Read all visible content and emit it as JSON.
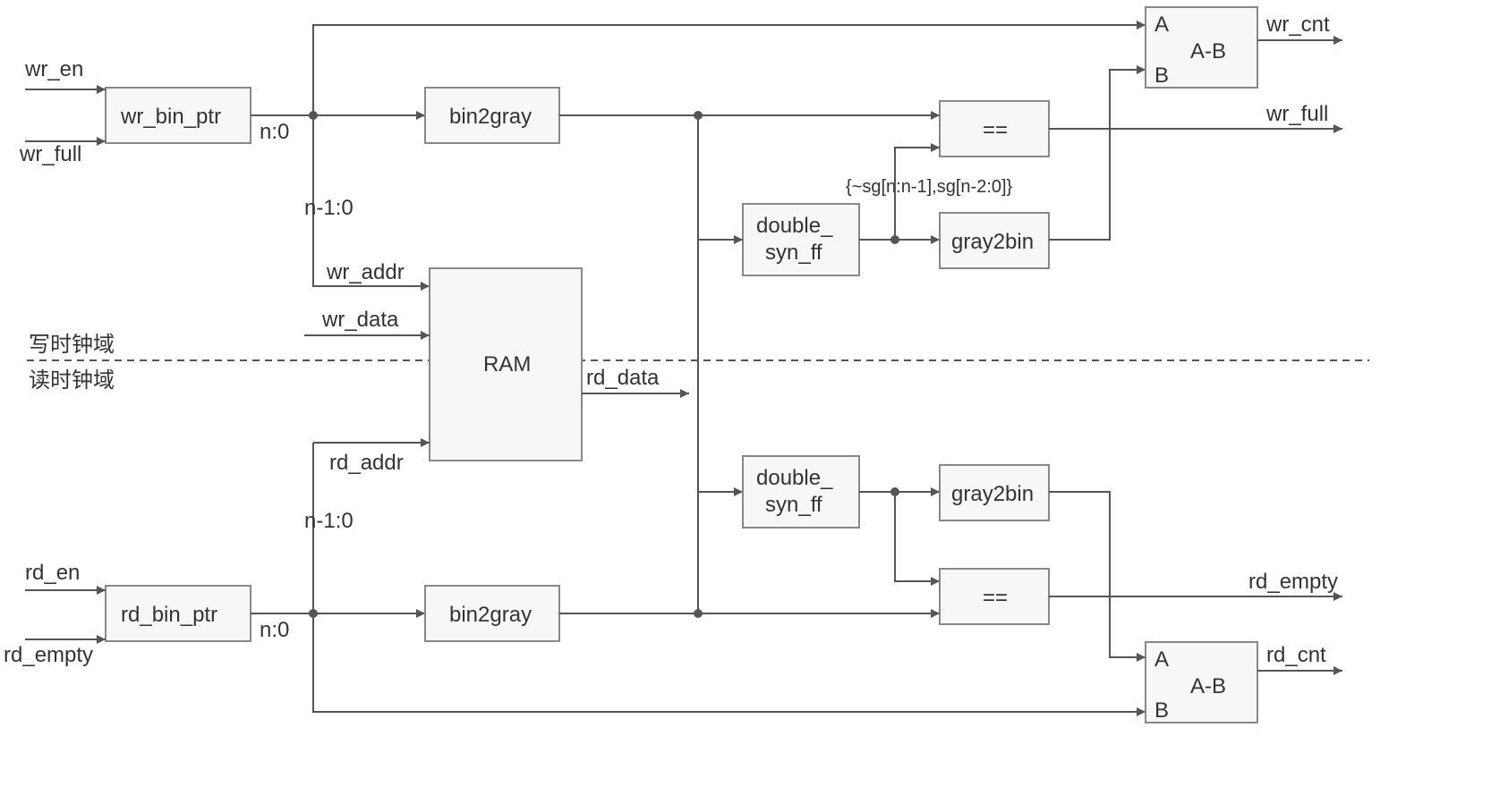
{
  "signals": {
    "wr_en": "wr_en",
    "wr_full": "wr_full",
    "rd_en": "rd_en",
    "rd_empty": "rd_empty",
    "wr_addr": "wr_addr",
    "wr_data": "wr_data",
    "rd_addr": "rd_addr",
    "rd_data": "rd_data",
    "wr_cnt": "wr_cnt",
    "wr_full_out": "wr_full",
    "rd_empty_out": "rd_empty",
    "rd_cnt": "rd_cnt",
    "n0_top": "n:0",
    "n0_bot": "n:0",
    "n1_top": "n-1:0",
    "n1_bot": "n-1:0",
    "sg_expr": "{~sg[n:n-1],sg[n-2:0]}",
    "A_top": "A",
    "B_top": "B",
    "A_bot": "A",
    "B_bot": "B"
  },
  "blocks": {
    "wr_bin_ptr": "wr_bin_ptr",
    "rd_bin_ptr": "rd_bin_ptr",
    "bin2gray_top": "bin2gray",
    "bin2gray_bot": "bin2gray",
    "ram": "RAM",
    "dsyn_top": "double_\nsyn_ff",
    "dsyn_bot": "double_\nsyn_ff",
    "gray2bin_top": "gray2bin",
    "gray2bin_bot": "gray2bin",
    "eq_top": "==",
    "eq_bot": "==",
    "sub_top": "A-B",
    "sub_bot": "A-B"
  },
  "domains": {
    "write": "写时钟域",
    "read": "读时钟域"
  }
}
